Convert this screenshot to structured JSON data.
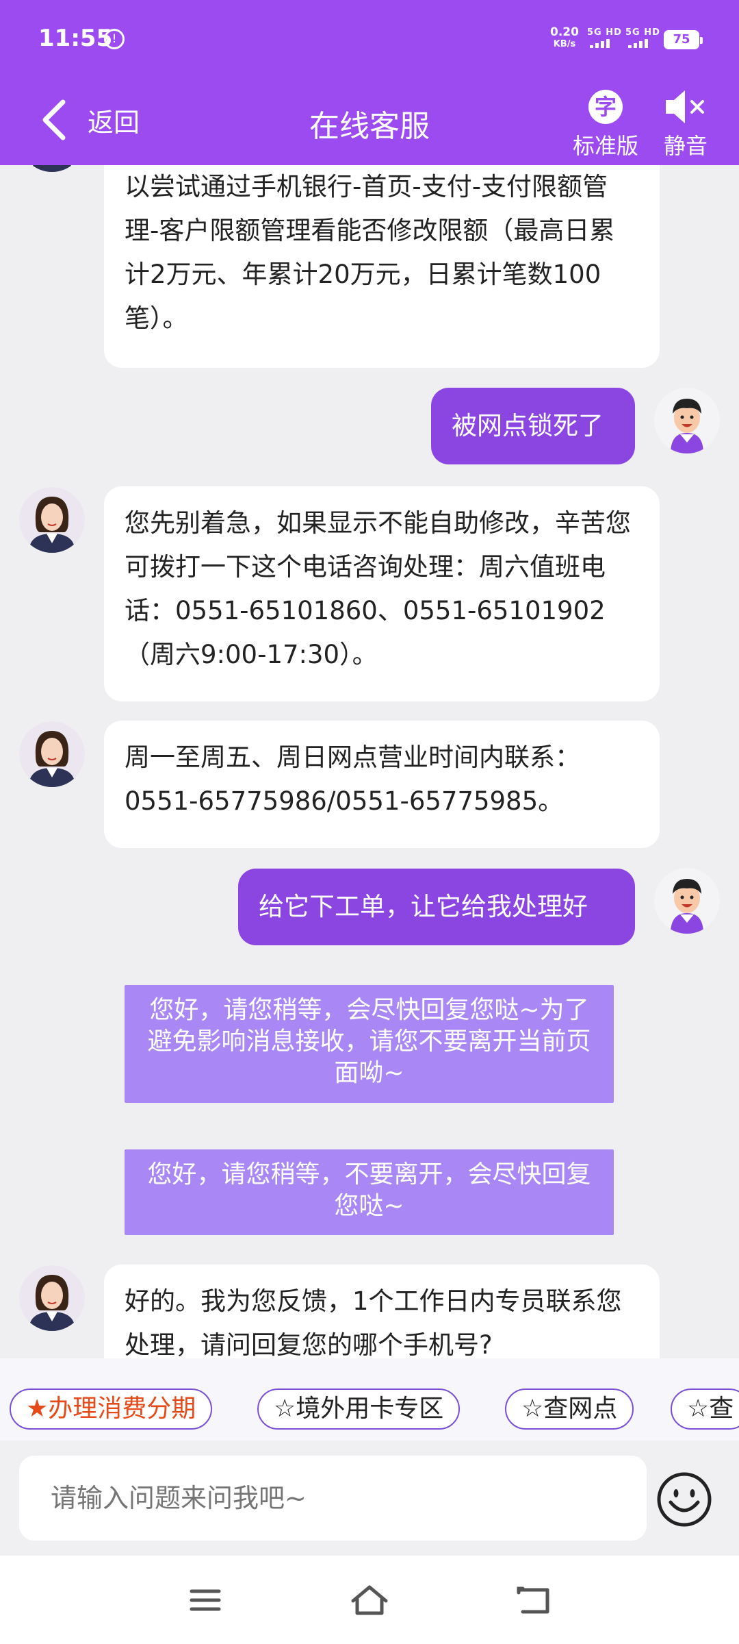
{
  "status_bar": {
    "time": "11:55",
    "time_icon": "⓫",
    "net_speed": "0.20",
    "net_unit": "KB/s",
    "sim1": "5G HD",
    "sim2": "5G HD",
    "battery": "75"
  },
  "header": {
    "back_label": "返回",
    "title": "在线客服",
    "version_icon": "字",
    "version_label": "标准版",
    "mute_label": "静音"
  },
  "messages": [
    {
      "from": "bot",
      "text": "以尝试通过手机银行-首页-支付-支付限额管理-客户限额管理看能否修改限额（最高日累计2万元、年累计20万元，日累计笔数100笔）。"
    },
    {
      "from": "user",
      "text": "被网点锁死了"
    },
    {
      "from": "bot",
      "text": "您先别着急，如果显示不能自助修改，辛苦您可拨打一下这个电话咨询处理：周六值班电话：0551-65101860、0551-65101902（周六9:00-17:30）。"
    },
    {
      "from": "bot",
      "text": "周一至周五、周日网点营业时间内联系：0551-65775986/0551-65775985。"
    },
    {
      "from": "user",
      "text": "给它下工单，让它给我处理好"
    },
    {
      "from": "system",
      "text": "您好，请您稍等，会尽快回复您哒~为了避免影响消息接收，请您不要离开当前页面呦~"
    },
    {
      "from": "system",
      "text": "您好，请您稍等，不要离开，会尽快回复您哒~"
    },
    {
      "from": "bot",
      "text": "好的。我为您反馈，1个工作日内专员联系您处理，请问回复您的哪个手机号?"
    }
  ],
  "quick_tags": [
    "★办理消费分期",
    "☆境外用卡专区",
    "☆查网点",
    "☆查"
  ],
  "input": {
    "placeholder": "请输入问题来问我吧~"
  },
  "colors": {
    "brand": "#9b4bf0",
    "user_bubble": "#8b46e2",
    "system_bubble": "#a987f4",
    "hot_tag": "#e64a19"
  }
}
